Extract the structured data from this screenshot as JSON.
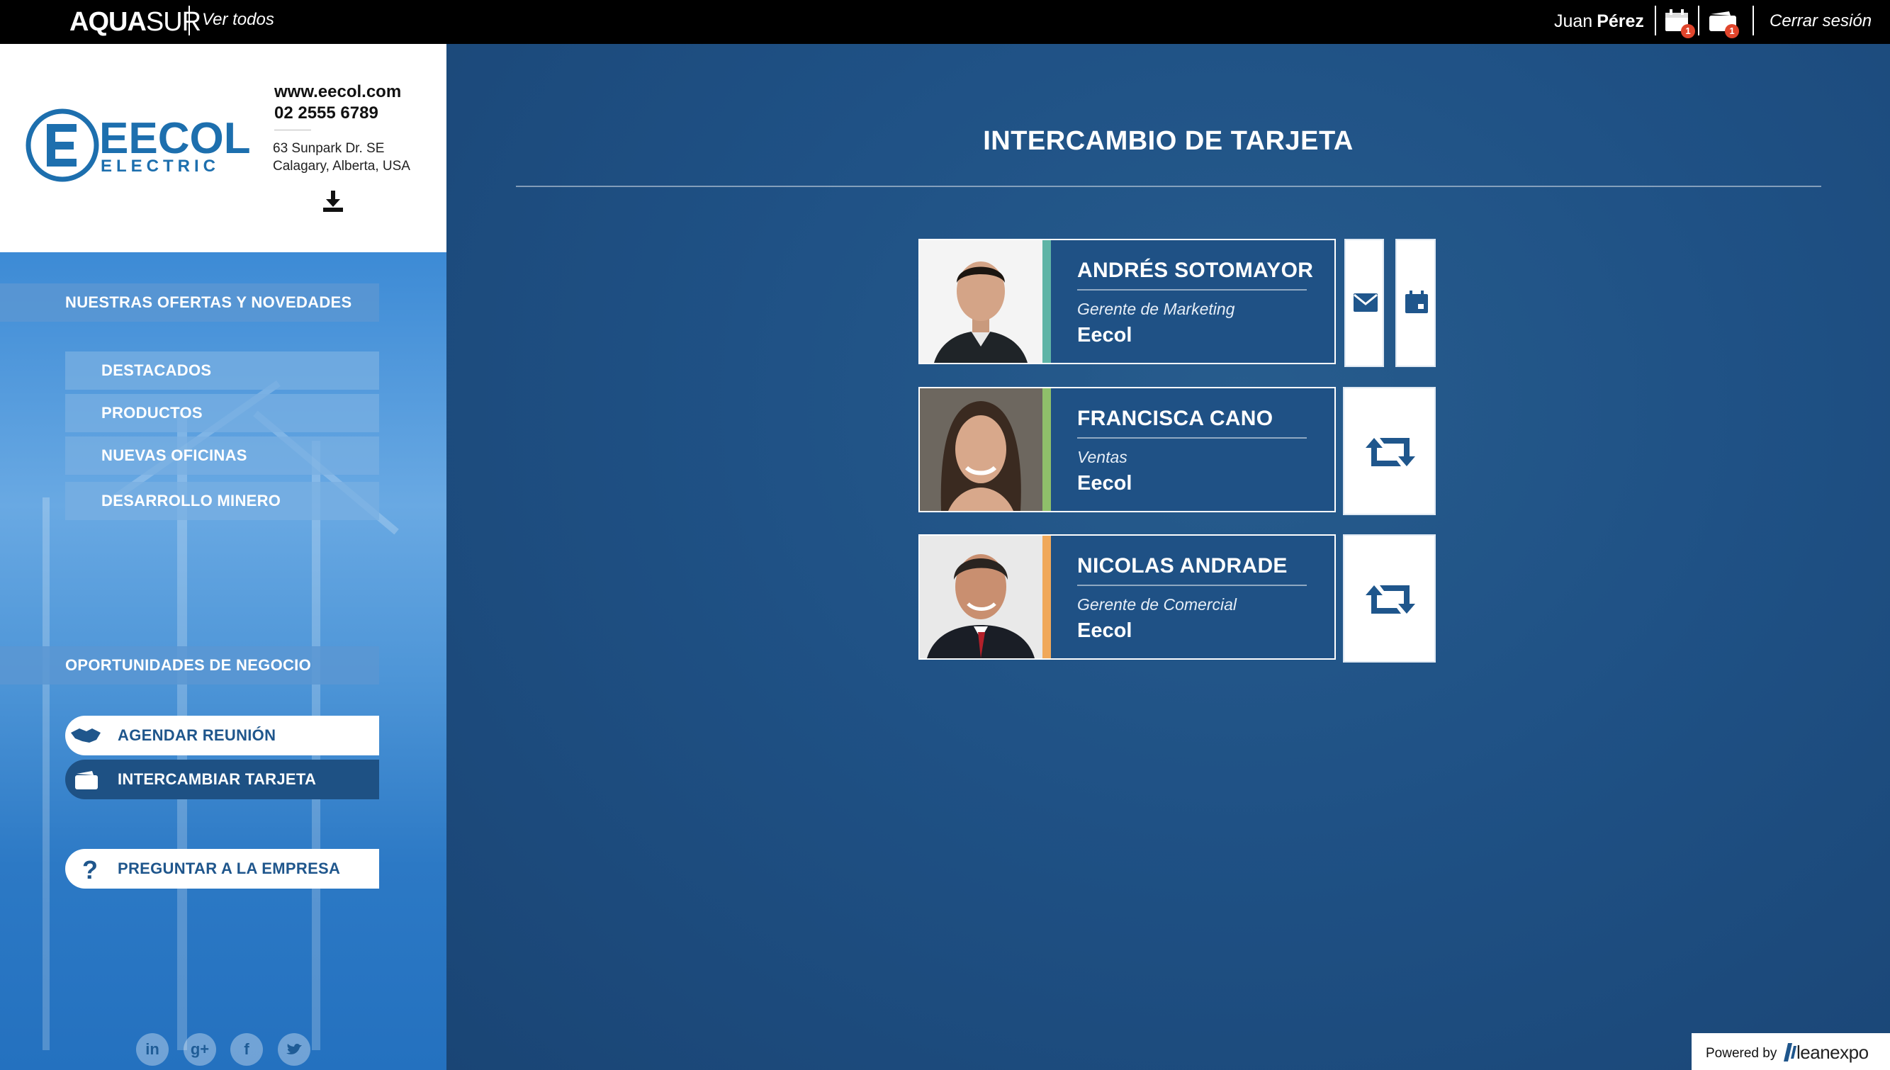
{
  "topbar": {
    "logo_bold": "AQUA",
    "logo_light": "SUR",
    "ver_todos": "Ver todos",
    "user_first": "Juan",
    "user_last": "Pérez",
    "calendar_badge": "1",
    "cards_badge": "1",
    "logout": "Cerrar sesión"
  },
  "company": {
    "logo_text_main": "EECOL",
    "logo_text_sub": "ELECTRIC",
    "website": "www.eecol.com",
    "phone": "02 2555 6789",
    "address_line1": "63 Sunpark Dr. SE",
    "address_line2": "Calagary, Alberta, USA"
  },
  "sidebar": {
    "offers_heading": "NUESTRAS OFERTAS Y NOVEDADES",
    "offers_items": [
      "DESTACADOS",
      "PRODUCTOS",
      "NUEVAS OFICINAS",
      "DESARROLLO MINERO"
    ],
    "business_heading": "OPORTUNIDADES DE NEGOCIO",
    "schedule_label": "AGENDAR REUNIÓN",
    "exchange_label": "INTERCAMBIAR TARJETA",
    "ask_label": "PREGUNTAR A LA EMPRESA",
    "social": [
      "in",
      "g+",
      "f",
      "twitter"
    ]
  },
  "main": {
    "title": "INTERCAMBIO DE TARJETA",
    "contacts": [
      {
        "name": "ANDRÉS SOTOMAYOR",
        "role": "Gerente de Marketing",
        "company": "Eecol",
        "stripe_color": "#5fb4a6",
        "actions": [
          "envelope-icon",
          "calendar-icon"
        ]
      },
      {
        "name": "FRANCISCA CANO",
        "role": "Ventas",
        "company": "Eecol",
        "stripe_color": "#8fbf6a",
        "actions": [
          "exchange-icon"
        ]
      },
      {
        "name": "NICOLAS ANDRADE",
        "role": "Gerente de Comercial",
        "company": "Eecol",
        "stripe_color": "#f0a85a",
        "actions": [
          "exchange-icon"
        ]
      }
    ]
  },
  "footer": {
    "powered_by": "Powered by",
    "brand": "leanexpo"
  },
  "colors": {
    "main_bg": "#1f5185",
    "accent": "#1f568c",
    "badge": "#e0452c"
  }
}
